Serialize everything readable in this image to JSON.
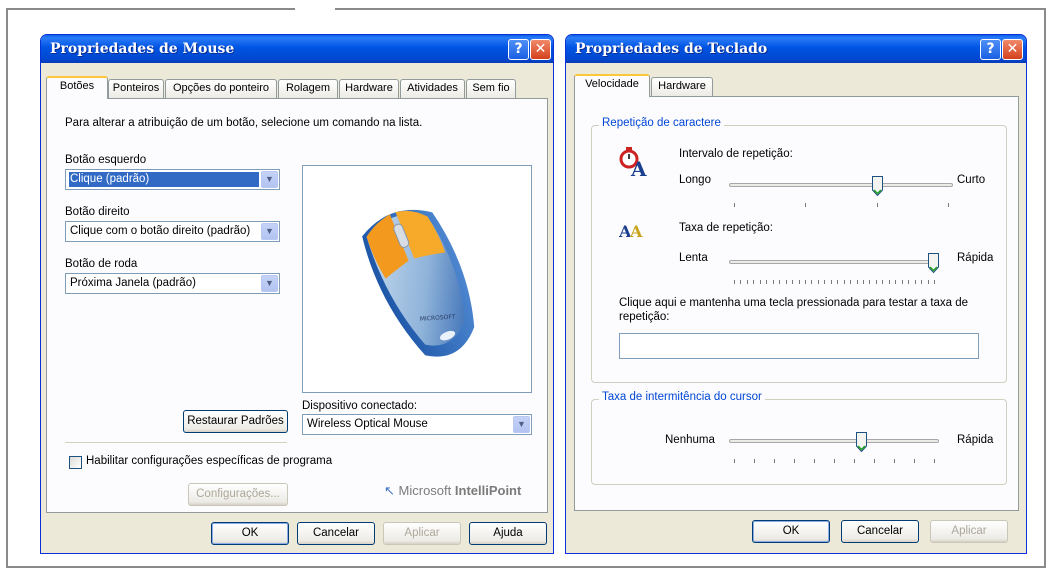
{
  "mouse": {
    "title": "Propriedades de Mouse",
    "help_glyph": "?",
    "close_glyph": "✕",
    "tabs": [
      "Botões",
      "Ponteiros",
      "Opções do ponteiro",
      "Rolagem",
      "Hardware",
      "Atividades",
      "Sem fio"
    ],
    "active_tab": "Botões",
    "instruction": "Para alterar a atribuição de um botão, selecione um comando na lista.",
    "left_button": {
      "label": "Botão esquerdo",
      "value": "Clique (padrão)"
    },
    "right_button": {
      "label": "Botão direito",
      "value": "Clique com o botão direito (padrão)"
    },
    "wheel_button": {
      "label": "Botão de roda",
      "value": "Próxima Janela (padrão)"
    },
    "restore_button": "Restaurar Padrões",
    "device": {
      "label": "Dispositivo conectado:",
      "value": "Wireless Optical Mouse"
    },
    "checkbox_label": "Habilitar configurações específicas de programa",
    "checkbox_checked": false,
    "settings_button": "Configurações...",
    "brand": "Microsoft",
    "brand_product": "IntelliPoint",
    "buttons": {
      "ok": "OK",
      "cancel": "Cancelar",
      "apply": "Aplicar",
      "help": "Ajuda"
    }
  },
  "keyboard": {
    "title": "Propriedades de Teclado",
    "help_glyph": "?",
    "close_glyph": "✕",
    "tabs": [
      "Velocidade",
      "Hardware"
    ],
    "active_tab": "Velocidade",
    "repeat_group": "Repetição de caractere",
    "delay": {
      "label": "Intervalo de repetição:",
      "min_label": "Longo",
      "max_label": "Curto",
      "value_fraction": 0.67
    },
    "rate": {
      "label": "Taxa de repetição:",
      "min_label": "Lenta",
      "max_label": "Rápida",
      "value_fraction": 1.0
    },
    "test_label": "Clique aqui e mantenha uma tecla pressionada para testar a taxa de repetição:",
    "test_value": "",
    "cursor_group": "Taxa de intermitência do cursor",
    "blink": {
      "min_label": "Nenhuma",
      "max_label": "Rápida",
      "value_fraction": 0.64
    },
    "buttons": {
      "ok": "OK",
      "cancel": "Cancelar",
      "apply": "Aplicar"
    }
  },
  "colors": {
    "titlebar": "#0054e3",
    "selection": "#316ac5",
    "group_title": "#0046d5",
    "mouse_buttons": "#f39a1e",
    "mouse_body": "#8fb3d9"
  }
}
